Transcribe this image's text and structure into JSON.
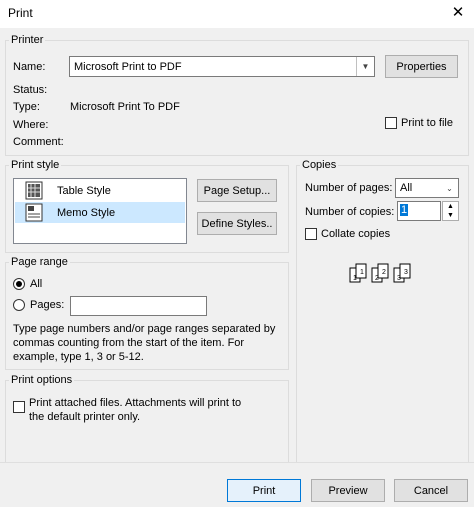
{
  "window": {
    "title": "Print",
    "close_glyph": "✕"
  },
  "printer": {
    "group_label": "Printer",
    "name_label": "Name:",
    "name_value": "Microsoft Print to PDF",
    "properties_button": "Properties",
    "status_label": "Status:",
    "status_value": "",
    "type_label": "Type:",
    "type_value": "Microsoft Print To PDF",
    "where_label": "Where:",
    "where_value": "",
    "comment_label": "Comment:",
    "comment_value": "",
    "print_to_file_label": "Print to file"
  },
  "print_style": {
    "group_label": "Print style",
    "items": [
      {
        "label": "Table Style",
        "selected": false,
        "icon": "table-style-icon"
      },
      {
        "label": "Memo Style",
        "selected": true,
        "icon": "memo-style-icon"
      }
    ],
    "page_setup_button": "Page Setup...",
    "define_styles_button": "Define Styles.."
  },
  "copies": {
    "group_label": "Copies",
    "number_of_pages_label": "Number of pages:",
    "number_of_pages_value": "All",
    "number_of_copies_label": "Number of copies:",
    "number_of_copies_value": "1",
    "collate_label": "Collate copies",
    "collate_checked": false,
    "collate_icon_numbers": [
      "1",
      "1",
      "2",
      "2",
      "3",
      "3"
    ]
  },
  "page_range": {
    "group_label": "Page range",
    "all_label": "All",
    "all_selected": true,
    "pages_label": "Pages:",
    "pages_value": "",
    "help_text": "Type page numbers and/or page ranges separated by commas counting from the start of the item.  For example, type 1, 3 or 5-12."
  },
  "print_options": {
    "group_label": "Print options",
    "attachments_label": "Print attached files.  Attachments will print to the default printer only.",
    "attachments_checked": false
  },
  "footer": {
    "print_button": "Print",
    "preview_button": "Preview",
    "cancel_button": "Cancel"
  },
  "colors": {
    "dialog_bg": "#f0f0f0",
    "selected_row": "#cce8ff",
    "focus_border": "#0078d7"
  }
}
